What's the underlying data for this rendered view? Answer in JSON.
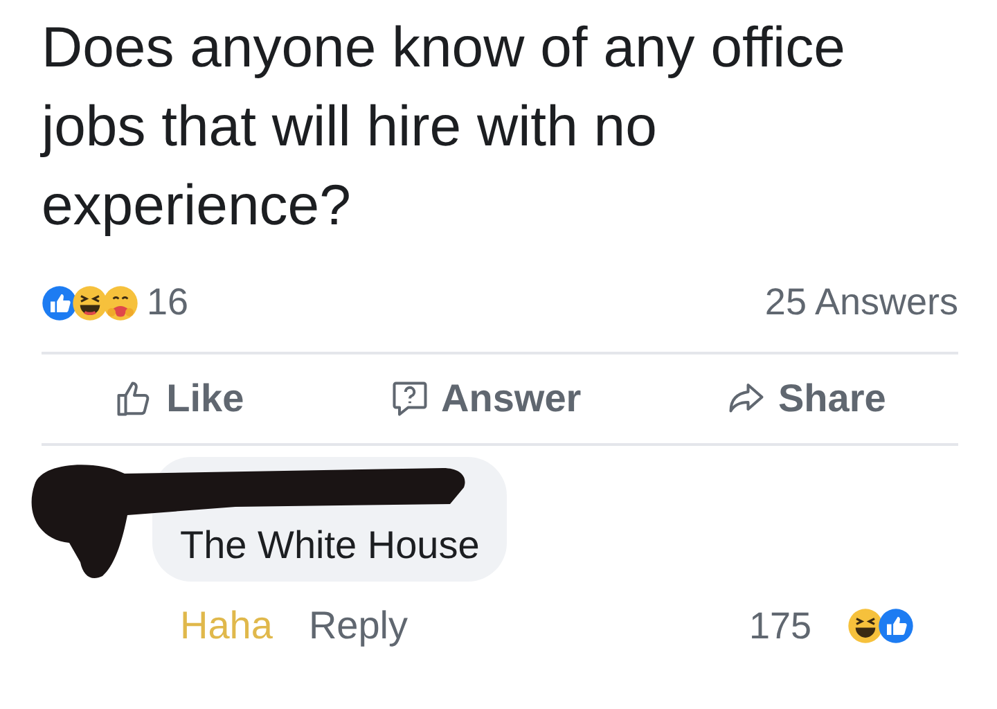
{
  "post": {
    "question": "Does anyone know of any office jobs that will hire with no experience?",
    "reaction_count": "16",
    "answers_count": "25 Answers"
  },
  "actions": [
    {
      "kind": "like",
      "label": "Like"
    },
    {
      "kind": "answer",
      "label": "Answer"
    },
    {
      "kind": "share",
      "label": "Share"
    }
  ],
  "comment": {
    "text": "The White House",
    "reaction": {
      "label": "Haha",
      "selected": true
    },
    "reply": "Reply",
    "reaction_count": "175"
  }
}
